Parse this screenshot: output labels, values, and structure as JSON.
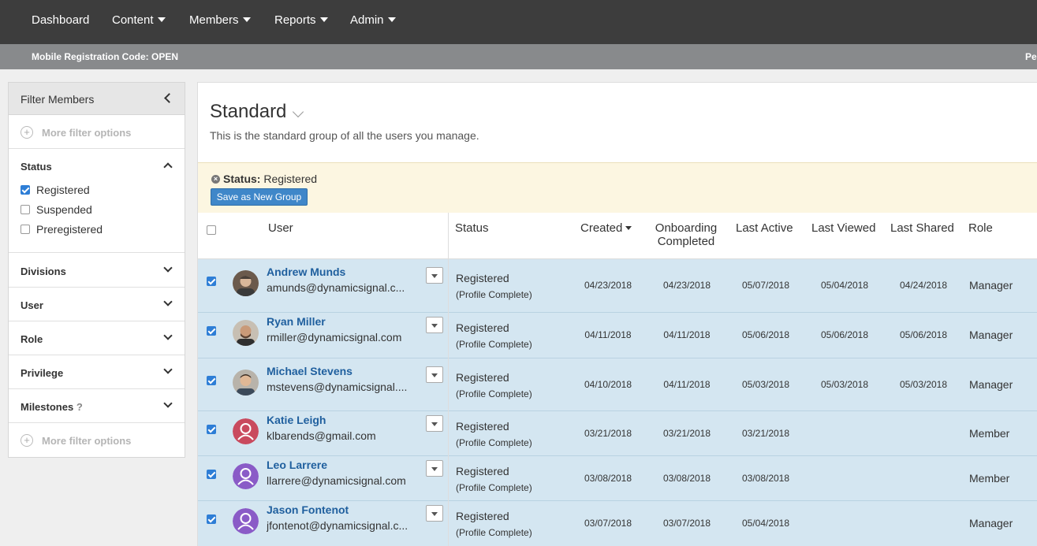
{
  "nav": {
    "items": [
      {
        "label": "Dashboard",
        "dropdown": false
      },
      {
        "label": "Content",
        "dropdown": true
      },
      {
        "label": "Members",
        "dropdown": true
      },
      {
        "label": "Reports",
        "dropdown": true
      },
      {
        "label": "Admin",
        "dropdown": true
      }
    ]
  },
  "subbar": {
    "registration_code": "Mobile Registration Code: OPEN",
    "right_text": "Pe"
  },
  "sidebar": {
    "title": "Filter Members",
    "more_filter_options": "More filter options",
    "status": {
      "title": "Status",
      "options": [
        {
          "label": "Registered",
          "checked": true
        },
        {
          "label": "Suspended",
          "checked": false
        },
        {
          "label": "Preregistered",
          "checked": false
        }
      ]
    },
    "sections": [
      "Divisions",
      "User",
      "Role",
      "Privilege",
      "Milestones"
    ],
    "milestones_help": "?"
  },
  "main": {
    "title": "Standard",
    "description": "This is the standard group of all the users you manage.",
    "filter_label": "Status:",
    "filter_value": "Registered",
    "save_button": "Save as New Group"
  },
  "table": {
    "headers": {
      "user": "User",
      "status": "Status",
      "created": "Created",
      "onboarding_1": "Onboarding",
      "onboarding_2": "Completed",
      "last_active": "Last Active",
      "last_viewed": "Last Viewed",
      "last_shared": "Last Shared",
      "role": "Role"
    },
    "rows": [
      {
        "name": "Andrew Munds",
        "email": "amunds@dynamicsignal.c...",
        "status": "Registered",
        "status_sub": "(Profile Complete)",
        "created": "04/23/2018",
        "onboarding": "04/23/2018",
        "last_active": "05/07/2018",
        "last_viewed": "05/04/2018",
        "last_shared": "04/24/2018",
        "role": "Manager",
        "avatar": "photo-1"
      },
      {
        "name": "Ryan Miller",
        "email": "rmiller@dynamicsignal.com",
        "status": "Registered",
        "status_sub": "(Profile Complete)",
        "created": "04/11/2018",
        "onboarding": "04/11/2018",
        "last_active": "05/06/2018",
        "last_viewed": "05/06/2018",
        "last_shared": "05/06/2018",
        "role": "Manager",
        "avatar": "photo-2"
      },
      {
        "name": "Michael Stevens",
        "email": "mstevens@dynamicsignal....",
        "status": "Registered",
        "status_sub": "(Profile Complete)",
        "created": "04/10/2018",
        "onboarding": "04/11/2018",
        "last_active": "05/03/2018",
        "last_viewed": "05/03/2018",
        "last_shared": "05/03/2018",
        "role": "Manager",
        "avatar": "photo-3"
      },
      {
        "name": "Katie Leigh",
        "email": "klbarends@gmail.com",
        "status": "Registered",
        "status_sub": "(Profile Complete)",
        "created": "03/21/2018",
        "onboarding": "03/21/2018",
        "last_active": "03/21/2018",
        "last_viewed": "",
        "last_shared": "",
        "role": "Member",
        "avatar": "default-red"
      },
      {
        "name": "Leo Larrere",
        "email": "llarrere@dynamicsignal.com",
        "status": "Registered",
        "status_sub": "(Profile Complete)",
        "created": "03/08/2018",
        "onboarding": "03/08/2018",
        "last_active": "03/08/2018",
        "last_viewed": "",
        "last_shared": "",
        "role": "Member",
        "avatar": "default-purple"
      },
      {
        "name": "Jason Fontenot",
        "email": "jfontenot@dynamicsignal.c...",
        "status": "Registered",
        "status_sub": "(Profile Complete)",
        "created": "03/07/2018",
        "onboarding": "03/07/2018",
        "last_active": "05/04/2018",
        "last_viewed": "",
        "last_shared": "",
        "role": "Manager",
        "avatar": "default-purple"
      }
    ]
  },
  "colors": {
    "nav_bg": "#3d3d3d",
    "subbar_bg": "#888a8c",
    "link_blue": "#1f5f9e",
    "row_selected": "#d4e6f1",
    "filter_bar": "#fcf6e1",
    "button_blue": "#3f87c9",
    "avatar_red": "#c94a5e",
    "avatar_purple": "#8a5bc7"
  }
}
